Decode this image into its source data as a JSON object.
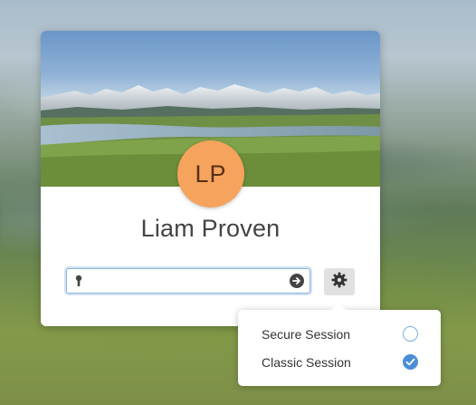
{
  "user": {
    "initials": "LP",
    "name": "Liam Proven"
  },
  "login": {
    "password_value": "",
    "icons": {
      "field": "key-icon",
      "submit": "arrow-right-circle-icon",
      "settings": "gear-icon"
    }
  },
  "session_menu": {
    "items": [
      {
        "label": "Secure Session",
        "selected": false
      },
      {
        "label": "Classic Session",
        "selected": true
      }
    ]
  },
  "colors": {
    "avatar": "#f5a35d",
    "avatar_text": "#5a2f12",
    "accent": "#4a8ed8",
    "name_text": "#444444"
  }
}
